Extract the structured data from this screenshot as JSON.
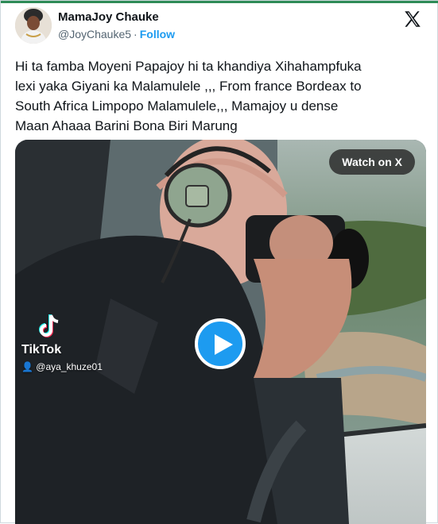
{
  "author": {
    "display_name": "MamaJoy Chauke",
    "handle": "@JoyChauke5",
    "separator": "·",
    "follow_label": "Follow"
  },
  "tweet": {
    "text": "Hi ta famba Moyeni Papajoy hi ta khandiya Xihahampfuka\nlexi yaka Giyani ka Malamulele ,,, From france Bordeax to\nSouth Africa Limpopo Malamulele,,, Mamajoy u dense\nMaan Ahaaa Barini Bona Biri Marung"
  },
  "media": {
    "watch_label": "Watch on X",
    "tiktok_brand": "TikTok",
    "tiktok_user": "@aya_khuze01"
  },
  "colors": {
    "accent": "#1d9bf0",
    "text": "#0f1419",
    "muted": "#536471"
  },
  "icons": {
    "brand": "x-logo-icon",
    "play": "play-icon",
    "tiktok": "tiktok-logo-icon",
    "user": "person-icon"
  }
}
